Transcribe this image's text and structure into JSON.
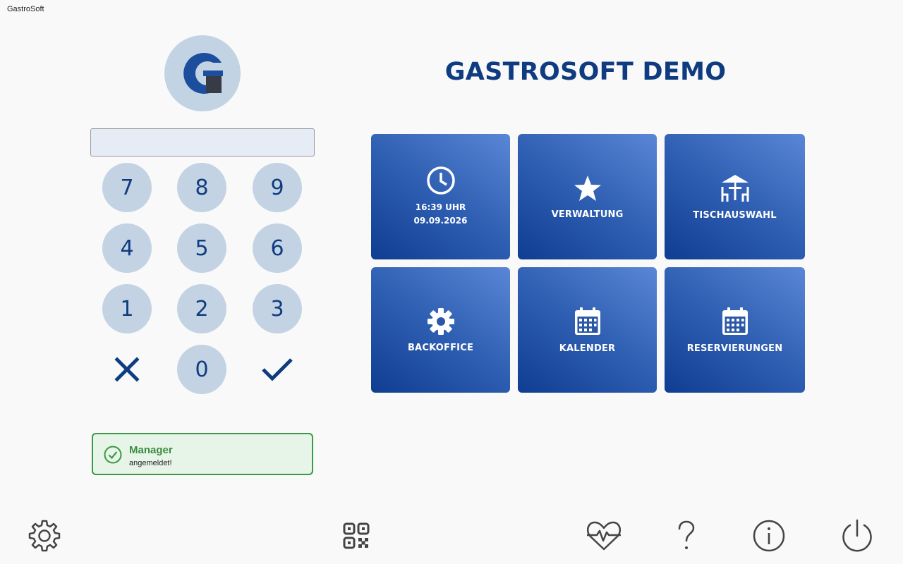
{
  "window": {
    "title": "GastroSoft"
  },
  "pin": {
    "value": ""
  },
  "keypad": {
    "k7": "7",
    "k8": "8",
    "k9": "9",
    "k4": "4",
    "k5": "5",
    "k6": "6",
    "k1": "1",
    "k2": "2",
    "k3": "3",
    "k0": "0",
    "cancel_icon": "close-icon",
    "confirm_icon": "checkmark-icon"
  },
  "status": {
    "title": "Manager",
    "message": "angemeldet!",
    "color": "#3b9a44"
  },
  "header": {
    "title": "GASTROSOFT DEMO"
  },
  "tiles": {
    "clock": {
      "time": "16:39 UHR",
      "date": "09.09.2026",
      "icon": "clock-icon"
    },
    "verwaltung": {
      "label": "VERWALTUNG",
      "icon": "star-icon"
    },
    "tischauswahl": {
      "label": "TISCHAUSWAHL",
      "icon": "table-icon"
    },
    "backoffice": {
      "label": "BACKOFFICE",
      "icon": "gear-icon"
    },
    "kalender": {
      "label": "KALENDER",
      "icon": "calendar-icon"
    },
    "reservierungen": {
      "label": "RESERVIERUNGEN",
      "icon": "calendar-icon"
    }
  },
  "toolbar": {
    "icons": [
      "settings-icon",
      "qr-code-icon",
      "heartbeat-icon",
      "help-icon",
      "info-icon",
      "power-icon"
    ]
  },
  "colors": {
    "brand": "#0f3c80",
    "tile_dark": "#0f3d91",
    "tile_light": "#5a86d6",
    "key_bg": "#c3d3e3"
  }
}
